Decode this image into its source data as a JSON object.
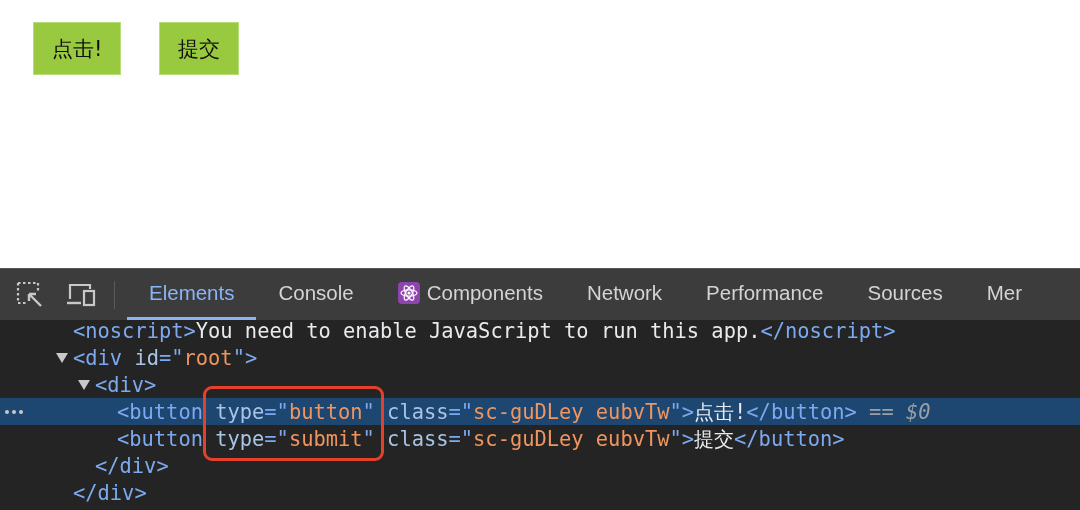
{
  "page": {
    "buttons": [
      "点击!",
      "提交"
    ]
  },
  "devtools": {
    "tabs": [
      {
        "label": "Elements",
        "kind": "panel",
        "selected": true
      },
      {
        "label": "Console",
        "kind": "panel",
        "selected": false
      },
      {
        "label": "Components",
        "kind": "extension",
        "selected": false
      },
      {
        "label": "Network",
        "kind": "panel",
        "selected": false
      },
      {
        "label": "Performance",
        "kind": "panel",
        "selected": false
      },
      {
        "label": "Sources",
        "kind": "panel",
        "selected": false
      },
      {
        "label": "Mer",
        "kind": "panel",
        "selected": false
      }
    ],
    "elements_tree": [
      {
        "selected": false,
        "tokens": [
          {
            "kind": "tag",
            "text": "<noscript>"
          },
          {
            "kind": "text",
            "text": "You need to enable JavaScript to run this app."
          },
          {
            "kind": "tag",
            "text": "</noscript>"
          }
        ]
      },
      {
        "selected": false,
        "expanded": true,
        "tokens": [
          {
            "kind": "tag",
            "text": "<div"
          },
          {
            "kind": "attr",
            "text": " id"
          },
          {
            "kind": "tag",
            "text": "=\""
          },
          {
            "kind": "value",
            "text": "root"
          },
          {
            "kind": "tag",
            "text": "\">"
          }
        ],
        "children": [
          {
            "selected": false,
            "expanded": true,
            "tokens": [
              {
                "kind": "tag",
                "text": "<div>"
              }
            ],
            "children": [
              {
                "selected": true,
                "tokens": [
                  {
                    "kind": "tag",
                    "text": "<button"
                  },
                  {
                    "kind": "attr",
                    "text": " type"
                  },
                  {
                    "kind": "tag",
                    "text": "=\""
                  },
                  {
                    "kind": "value",
                    "text": "button"
                  },
                  {
                    "kind": "tag",
                    "text": "\""
                  },
                  {
                    "kind": "attr",
                    "text": " class"
                  },
                  {
                    "kind": "tag",
                    "text": "=\""
                  },
                  {
                    "kind": "value",
                    "text": "sc-guDLey eubvTw"
                  },
                  {
                    "kind": "tag",
                    "text": "\">"
                  },
                  {
                    "kind": "text",
                    "text": "点击!"
                  },
                  {
                    "kind": "tag",
                    "text": "</button>"
                  },
                  {
                    "kind": "hint",
                    "text": " == *$0*"
                  }
                ]
              },
              {
                "selected": false,
                "tokens": [
                  {
                    "kind": "tag",
                    "text": "<button"
                  },
                  {
                    "kind": "attr",
                    "text": " type"
                  },
                  {
                    "kind": "tag",
                    "text": "=\""
                  },
                  {
                    "kind": "value",
                    "text": "submit"
                  },
                  {
                    "kind": "tag",
                    "text": "\""
                  },
                  {
                    "kind": "attr",
                    "text": " class"
                  },
                  {
                    "kind": "tag",
                    "text": "=\""
                  },
                  {
                    "kind": "value",
                    "text": "sc-guDLey eubvTw"
                  },
                  {
                    "kind": "tag",
                    "text": "\">"
                  },
                  {
                    "kind": "text",
                    "text": "提交"
                  },
                  {
                    "kind": "tag",
                    "text": "</button>"
                  }
                ]
              }
            ],
            "closing": [
              {
                "kind": "tag",
                "text": "</div>"
              }
            ]
          }
        ],
        "closing": [
          {
            "kind": "tag",
            "text": "</div>"
          }
        ]
      }
    ]
  }
}
